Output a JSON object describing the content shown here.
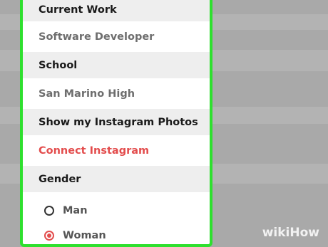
{
  "profile": {
    "current_work": {
      "label": "Current Work",
      "value": "Software Developer"
    },
    "school": {
      "label": "School",
      "value": "San Marino High"
    },
    "instagram": {
      "label": "Show my Instagram Photos",
      "link": "Connect Instagram"
    },
    "gender": {
      "label": "Gender",
      "options": [
        "Man",
        "Woman"
      ],
      "selected": "Woman"
    }
  },
  "colors": {
    "card_border": "#2ee02e",
    "accent": "#e34d4d",
    "header_bg": "#eeeeee"
  },
  "watermark": {
    "text": "wikiHow"
  }
}
